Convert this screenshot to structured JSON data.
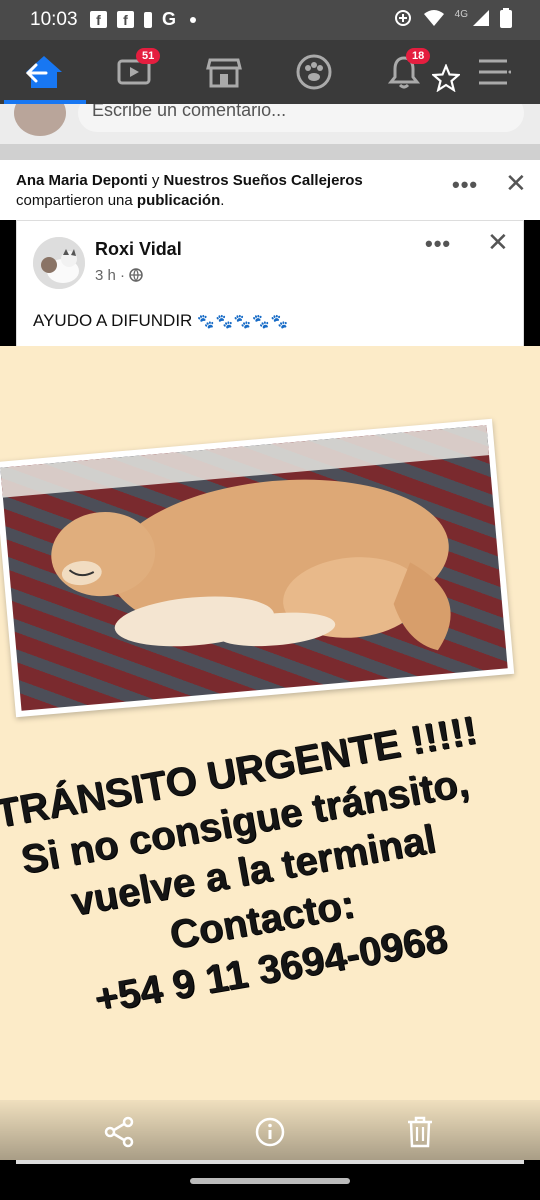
{
  "status_bar": {
    "time": "10:03",
    "network_label": "4G"
  },
  "tabs": {
    "watch_badge": "51",
    "notifications_badge": "18"
  },
  "comment": {
    "placeholder": "Escribe un comentario..."
  },
  "share": {
    "user1": "Ana Maria Deponti",
    "conj": " y ",
    "user2": "Nuestros Sueños Callejeros",
    "line2_prefix": "compartieron una ",
    "line2_bold": "publicación",
    "line2_suffix": "."
  },
  "post": {
    "author": "Roxi Vidal",
    "time": "3 h",
    "text": "AYUDO A DIFUNDIR",
    "paws": "🐾🐾🐾🐾🐾"
  },
  "poster": {
    "lines": [
      "TRÁNSITO URGENTE !!!!!",
      "Si no consigue tránsito,",
      "vuelve a la terminal",
      "Contacto:",
      "+54 9 11 3694-0968"
    ]
  },
  "icons": {
    "back": "back-arrow-icon",
    "home": "home-icon",
    "watch": "watch-icon",
    "marketplace": "marketplace-icon",
    "groups": "groups-icon",
    "notifications": "bell-icon",
    "star": "star-icon",
    "menu": "menu-icon",
    "share": "share-icon",
    "info": "info-icon",
    "delete": "trash-icon"
  },
  "colors": {
    "fb_blue": "#1877f2",
    "badge_red": "#e41e3f",
    "poster_bg": "#fcebc8"
  }
}
